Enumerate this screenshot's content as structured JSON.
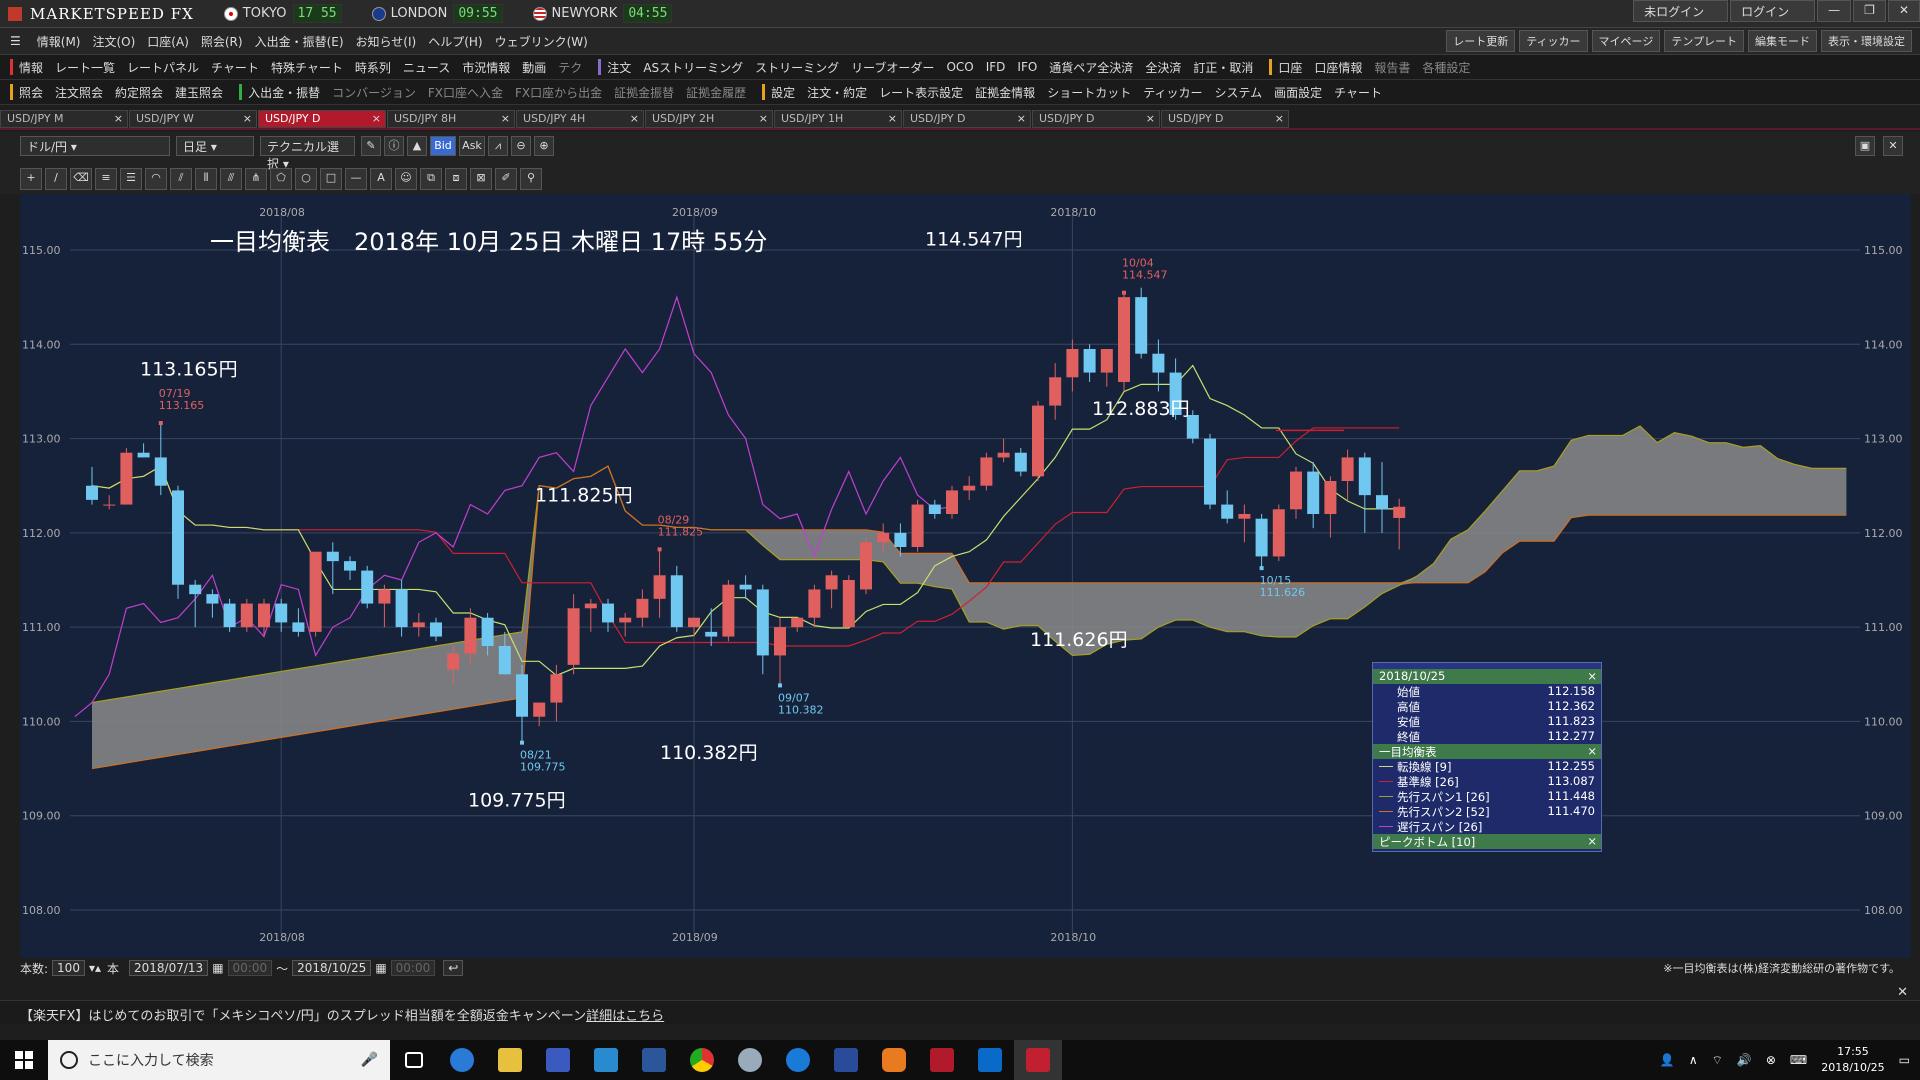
{
  "app": {
    "name": "MARKETSPEED FX",
    "clocks": [
      {
        "city": "TOKYO",
        "time": "17 55"
      },
      {
        "city": "LONDON",
        "time": "09:55"
      },
      {
        "city": "NEWYORK",
        "time": "04:55"
      }
    ],
    "login_status": "未ログイン",
    "login_button": "ログイン"
  },
  "menubar": {
    "items": [
      "情報(M)",
      "注文(O)",
      "口座(A)",
      "照会(R)",
      "入出金・振替(E)",
      "お知らせ(I)",
      "ヘルプ(H)",
      "ウェブリンク(W)"
    ],
    "right": [
      "レート更新",
      "ティッカー",
      "マイページ",
      "テンプレート",
      "編集モード",
      "表示・環境設定"
    ]
  },
  "toolbar1": {
    "items": [
      "情報",
      "レート一覧",
      "レートパネル",
      "チャート",
      "特殊チャート",
      "時系列",
      "ニュース",
      "市況情報",
      "動画",
      "テク",
      "注文",
      "ASストリーミング",
      "ストリーミング",
      "リーブオーダー",
      "OCO",
      "IFD",
      "IFO",
      "通貨ペア全決済",
      "全決済",
      "訂正・取消",
      "口座",
      "口座情報",
      "報告書",
      "各種設定"
    ]
  },
  "toolbar2": {
    "items": [
      "照会",
      "注文照会",
      "約定照会",
      "建玉照会",
      "入出金・振替",
      "コンバージョン",
      "FX口座へ入金",
      "FX口座から出金",
      "証拠金振替",
      "証拠金履歴",
      "設定",
      "注文・約定",
      "レート表示設定",
      "証拠金情報",
      "ショートカット",
      "ティッカー",
      "システム",
      "画面設定",
      "チャート"
    ]
  },
  "tabs": [
    {
      "label": "USD/JPY M",
      "active": false
    },
    {
      "label": "USD/JPY W",
      "active": false
    },
    {
      "label": "USD/JPY D",
      "active": true
    },
    {
      "label": "USD/JPY 8H",
      "active": false
    },
    {
      "label": "USD/JPY 4H",
      "active": false
    },
    {
      "label": "USD/JPY 2H",
      "active": false
    },
    {
      "label": "USD/JPY 1H",
      "active": false
    },
    {
      "label": "USD/JPY D",
      "active": false
    },
    {
      "label": "USD/JPY D",
      "active": false
    },
    {
      "label": "USD/JPY D",
      "active": false
    }
  ],
  "chart_controls": {
    "pair": "ドル/円",
    "period": "日足",
    "technical": "テクニカル選択",
    "bid": "Bid",
    "ask": "Ask"
  },
  "chart_title": "一目均衡表　2018年 10月 25日 木曜日 17時 55分",
  "annotations": [
    {
      "label": "113.165円",
      "date": "07/19",
      "value": "113.165"
    },
    {
      "label": "111.825円",
      "date": "08/29",
      "value": "111.825"
    },
    {
      "label": "109.775円",
      "date": "08/21",
      "value": "109.775"
    },
    {
      "label": "110.382円",
      "date": "09/07",
      "value": "110.382"
    },
    {
      "label": "114.547円",
      "date": "10/04",
      "value": "114.547"
    },
    {
      "label": "112.883円"
    },
    {
      "label": "111.626円",
      "date": "10/15",
      "value": "111.626"
    }
  ],
  "chart_data": {
    "type": "candlestick",
    "title": "一目均衡表　2018年 10月 25日 木曜日 17時 55分",
    "x_ticks": [
      "2018/08",
      "2018/09",
      "2018/10"
    ],
    "y_ticks": [
      "115.00",
      "114.00",
      "113.00",
      "112.00",
      "111.00",
      "110.00",
      "109.00",
      "108.00"
    ],
    "ylim": [
      108.0,
      115.0
    ],
    "colors": {
      "up": "#e06060",
      "down": "#70c8f0",
      "tenkan": "#c8e070",
      "kijun": "#d02030",
      "span1": "#a8a020",
      "span2": "#d07020",
      "chikou": "#c040d0",
      "cloud": "#8a8a8a",
      "background": "#16213a"
    },
    "candles": [
      [
        112.5,
        112.7,
        112.3,
        112.35
      ],
      [
        112.3,
        112.4,
        112.25,
        112.3
      ],
      [
        112.3,
        112.9,
        112.3,
        112.85
      ],
      [
        112.85,
        112.95,
        112.8,
        112.8
      ],
      [
        112.8,
        113.165,
        112.4,
        112.5
      ],
      [
        112.45,
        112.5,
        111.3,
        111.45
      ],
      [
        111.45,
        111.5,
        111.0,
        111.35
      ],
      [
        111.35,
        111.4,
        111.1,
        111.25
      ],
      [
        111.25,
        111.3,
        110.95,
        111.0
      ],
      [
        111.0,
        111.3,
        110.95,
        111.25
      ],
      [
        111.0,
        111.3,
        110.9,
        111.25
      ],
      [
        111.25,
        111.3,
        110.95,
        111.05
      ],
      [
        111.05,
        111.2,
        110.9,
        110.95
      ],
      [
        110.95,
        111.8,
        110.9,
        111.8
      ],
      [
        111.8,
        111.9,
        111.35,
        111.7
      ],
      [
        111.7,
        111.75,
        111.5,
        111.6
      ],
      [
        111.6,
        111.65,
        111.2,
        111.25
      ],
      [
        111.25,
        111.45,
        111.0,
        111.4
      ],
      [
        111.4,
        111.5,
        110.9,
        111.0
      ],
      [
        111.0,
        111.15,
        110.9,
        111.05
      ],
      [
        111.05,
        111.1,
        110.85,
        110.9
      ],
      [
        110.55,
        110.8,
        110.4,
        110.72
      ],
      [
        110.72,
        111.2,
        110.6,
        111.1
      ],
      [
        111.1,
        111.15,
        110.7,
        110.8
      ],
      [
        110.8,
        110.95,
        110.5,
        110.5
      ],
      [
        110.5,
        110.6,
        109.775,
        110.05
      ],
      [
        110.05,
        110.2,
        109.95,
        110.2
      ],
      [
        110.2,
        110.6,
        110.0,
        110.5
      ],
      [
        110.6,
        111.35,
        110.5,
        111.2
      ],
      [
        111.2,
        111.3,
        110.95,
        111.25
      ],
      [
        111.25,
        111.3,
        110.95,
        111.05
      ],
      [
        111.05,
        111.15,
        110.9,
        111.1
      ],
      [
        111.1,
        111.4,
        111.0,
        111.3
      ],
      [
        111.3,
        111.825,
        111.1,
        111.55
      ],
      [
        111.55,
        111.65,
        110.95,
        111.0
      ],
      [
        111.0,
        111.1,
        110.9,
        111.1
      ],
      [
        110.95,
        111.2,
        110.8,
        110.9
      ],
      [
        110.9,
        111.5,
        110.85,
        111.45
      ],
      [
        111.45,
        111.55,
        111.3,
        111.4
      ],
      [
        111.4,
        111.45,
        110.5,
        110.7
      ],
      [
        110.7,
        111.1,
        110.382,
        111.0
      ],
      [
        111.0,
        111.1,
        110.95,
        111.1
      ],
      [
        111.1,
        111.45,
        111.0,
        111.4
      ],
      [
        111.4,
        111.6,
        111.2,
        111.55
      ],
      [
        111.0,
        111.55,
        111.0,
        111.5
      ],
      [
        111.4,
        111.95,
        111.35,
        111.9
      ],
      [
        111.9,
        112.1,
        111.8,
        112.0
      ],
      [
        112.0,
        112.1,
        111.75,
        111.85
      ],
      [
        111.85,
        112.35,
        111.8,
        112.3
      ],
      [
        112.3,
        112.35,
        112.15,
        112.2
      ],
      [
        112.2,
        112.5,
        112.15,
        112.45
      ],
      [
        112.45,
        112.6,
        112.35,
        112.5
      ],
      [
        112.5,
        112.85,
        112.45,
        112.8
      ],
      [
        112.8,
        113.0,
        112.75,
        112.85
      ],
      [
        112.85,
        112.9,
        112.6,
        112.65
      ],
      [
        112.6,
        113.4,
        112.55,
        113.35
      ],
      [
        113.35,
        113.8,
        113.2,
        113.65
      ],
      [
        113.65,
        114.05,
        113.5,
        113.95
      ],
      [
        113.95,
        114.0,
        113.6,
        113.7
      ],
      [
        113.7,
        113.95,
        113.55,
        113.95
      ],
      [
        113.6,
        114.547,
        113.5,
        114.5
      ],
      [
        114.5,
        114.6,
        113.85,
        113.9
      ],
      [
        113.9,
        114.05,
        113.5,
        113.7
      ],
      [
        113.7,
        113.85,
        113.2,
        113.25
      ],
      [
        113.25,
        113.3,
        112.95,
        113.0
      ],
      [
        113.0,
        113.05,
        112.25,
        112.3
      ],
      [
        112.3,
        112.45,
        112.1,
        112.15
      ],
      [
        112.15,
        112.3,
        111.9,
        112.2
      ],
      [
        112.15,
        112.2,
        111.626,
        111.75
      ],
      [
        111.75,
        112.3,
        111.7,
        112.25
      ],
      [
        112.25,
        112.7,
        112.15,
        112.65
      ],
      [
        112.65,
        112.75,
        112.05,
        112.2
      ],
      [
        112.2,
        112.6,
        111.95,
        112.55
      ],
      [
        112.55,
        112.883,
        112.35,
        112.8
      ],
      [
        112.8,
        112.85,
        112.0,
        112.4
      ],
      [
        112.4,
        112.75,
        112.0,
        112.25
      ],
      [
        112.158,
        112.362,
        111.823,
        112.277
      ]
    ]
  },
  "info_panel": {
    "date": "2018/10/25",
    "ohlc": [
      {
        "label": "始値",
        "value": "112.158"
      },
      {
        "label": "高値",
        "value": "112.362"
      },
      {
        "label": "安値",
        "value": "111.823"
      },
      {
        "label": "終値",
        "value": "112.277"
      }
    ],
    "ichimoku_header": "一目均衡表",
    "lines": [
      {
        "label": "転換線 [9]",
        "value": "112.255",
        "color": "#c8e070"
      },
      {
        "label": "基準線 [26]",
        "value": "113.087",
        "color": "#d02030"
      },
      {
        "label": "先行スパン1 [26]",
        "value": "111.448",
        "color": "#a8a020"
      },
      {
        "label": "先行スパン2 [52]",
        "value": "111.470",
        "color": "#d07020"
      },
      {
        "label": "遅行スパン [26]",
        "value": "",
        "color": "#c040d0"
      }
    ],
    "peak_header": "ピークボトム [10]"
  },
  "statusbar": {
    "count_label": "本数:",
    "count": "100",
    "unit": "本",
    "from": "2018/07/13",
    "from_time": "00:00",
    "to": "2018/10/25",
    "to_time": "00:00",
    "copyright": "※一目均衡表は(株)経済変動総研の著作物です。"
  },
  "news": {
    "text": "【楽天FX】はじめてのお取引で「メキシコペソ/円」のスプレッド相当額を全額返金キャンペーン",
    "link": "詳細はこちら"
  },
  "taskbar": {
    "search_placeholder": "ここに入力して検索",
    "time": "17:55",
    "date": "2018/10/25"
  }
}
